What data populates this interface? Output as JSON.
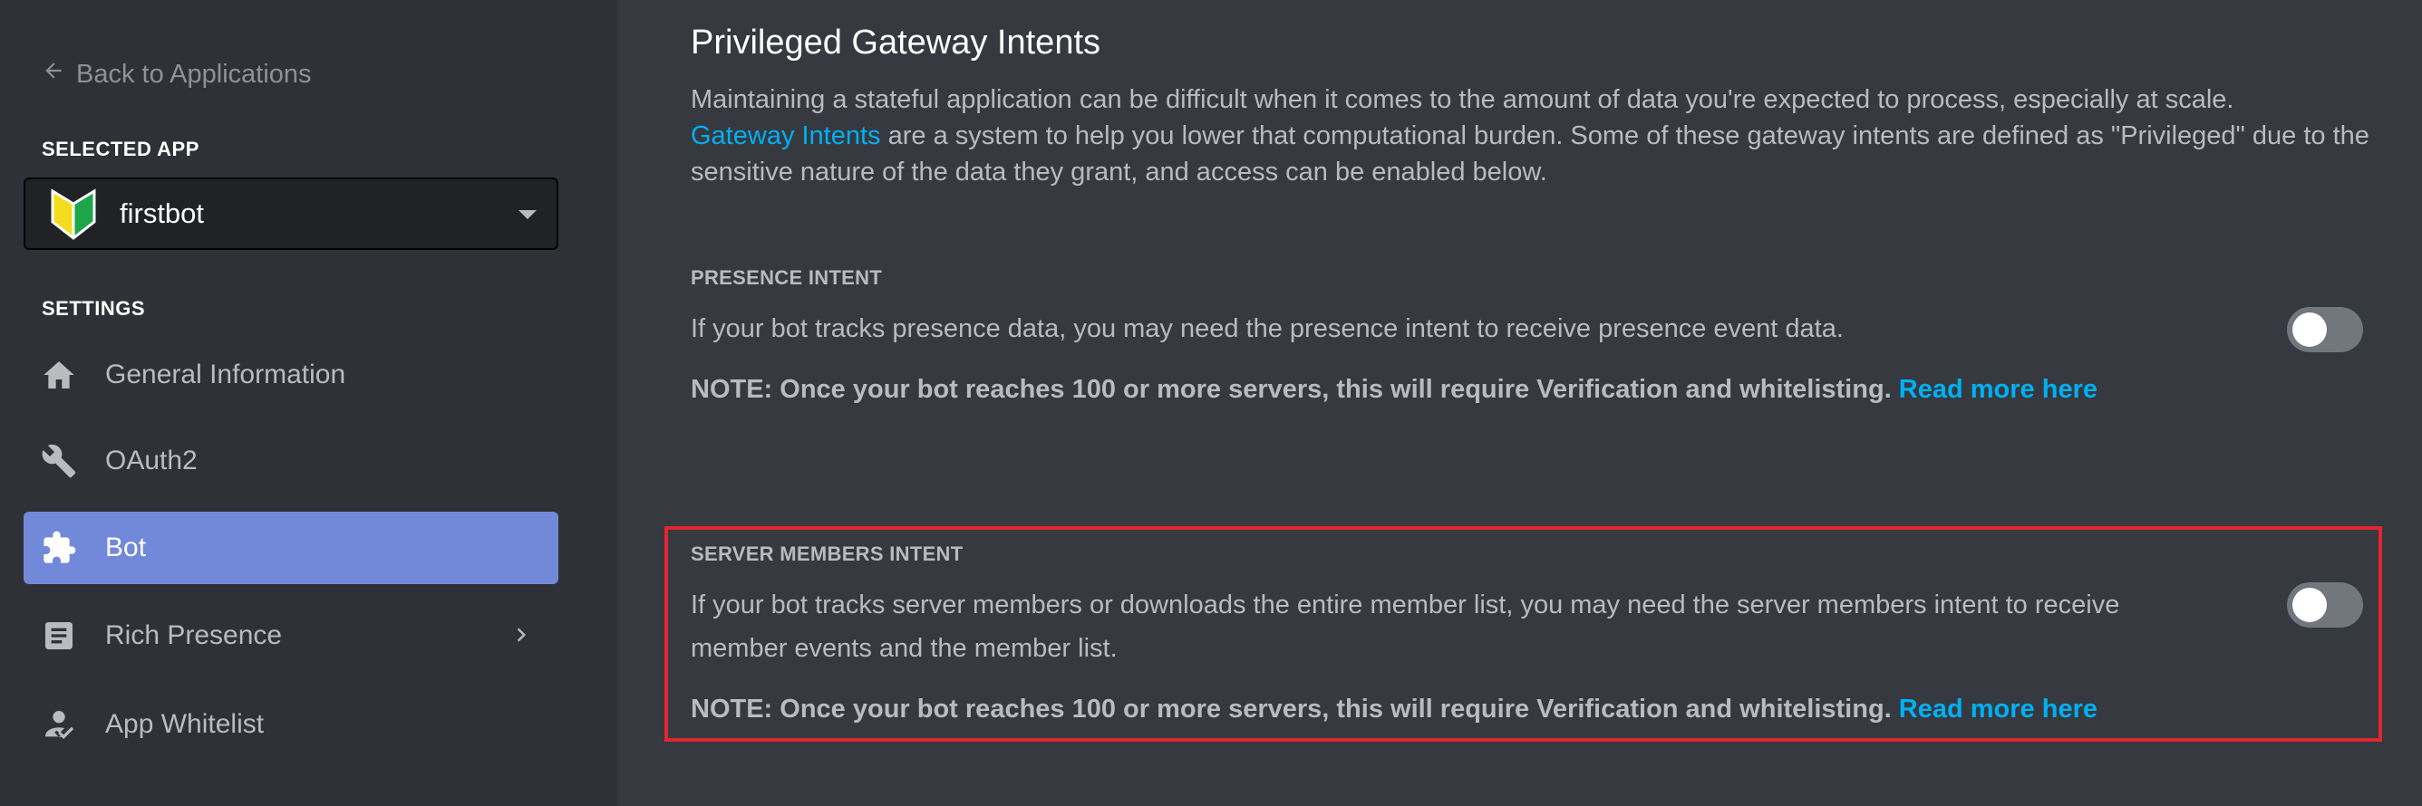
{
  "sidebar": {
    "back_label": "Back to Applications",
    "selected_app_heading": "SELECTED APP",
    "selected_app_name": "firstbot",
    "settings_heading": "SETTINGS",
    "items": [
      {
        "label": "General Information",
        "icon": "home-icon"
      },
      {
        "label": "OAuth2",
        "icon": "wrench-icon"
      },
      {
        "label": "Bot",
        "icon": "puzzle-icon",
        "active": true
      },
      {
        "label": "Rich Presence",
        "icon": "document-icon",
        "has_submenu": true
      },
      {
        "label": "App Whitelist",
        "icon": "user-check-icon"
      }
    ]
  },
  "main": {
    "title": "Privileged Gateway Intents",
    "description_line1": "Maintaining a stateful application can be difficult when it comes to the amount of data you're expected to process, especially at scale.",
    "description_link": "Gateway Intents",
    "description_rest": " are a system to help you lower that computational burden. Some of these gateway intents are defined as \"Privileged\" due to the sensitive nature of the data they grant, and access can be enabled below.",
    "presence": {
      "label": "PRESENCE INTENT",
      "text": "If your bot tracks presence data, you may need the presence intent to receive presence event data.",
      "note": "NOTE: Once your bot reaches 100 or more servers, this will require Verification and whitelisting.",
      "note_link": "Read more here",
      "enabled": false
    },
    "server_members": {
      "label": "SERVER MEMBERS INTENT",
      "text_line1": "If your bot tracks server members or downloads the entire member list, you may need the server members intent to receive",
      "text_line2": "member events and the member list.",
      "note": "NOTE: Once your bot reaches 100 or more servers, this will require Verification and whitelisting.",
      "note_link": "Read more here",
      "enabled": false
    }
  },
  "colors": {
    "background": "#36393f",
    "sidebar": "#2f3136",
    "accent": "#7289da",
    "link": "#00b0f4",
    "highlight": "#e22630"
  }
}
